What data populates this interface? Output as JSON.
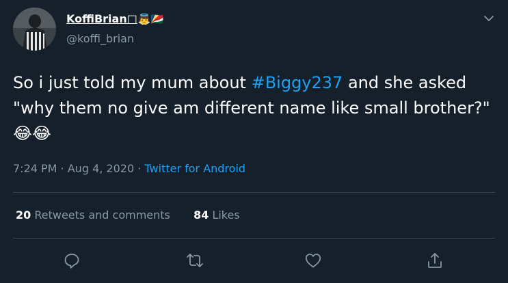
{
  "user": {
    "display_name": "KoffiBrian□",
    "display_emojis": "👼🇸🇨",
    "handle": "@koffi_brian"
  },
  "tweet": {
    "text_part1": "So i just told my mum about ",
    "hashtag": "#Biggy237",
    "text_part2": " and she asked \"why them no give am different name like small brother?\" ",
    "emojis": "😂😂"
  },
  "meta": {
    "time": "7:24 PM",
    "separator1": " · ",
    "date": "Aug 4, 2020",
    "separator2": " · ",
    "source": "Twitter for Android"
  },
  "stats": {
    "retweets_count": "20",
    "retweets_label": "Retweets and comments",
    "likes_count": "84",
    "likes_label": "Likes"
  },
  "icons": {
    "caret": "chevron-down-icon",
    "reply": "reply-icon",
    "retweet": "retweet-icon",
    "like": "heart-icon",
    "share": "share-icon"
  },
  "colors": {
    "background": "#15202b",
    "text": "#ffffff",
    "secondary": "#8899a6",
    "accent": "#1da1f2",
    "divider": "#38444d"
  }
}
